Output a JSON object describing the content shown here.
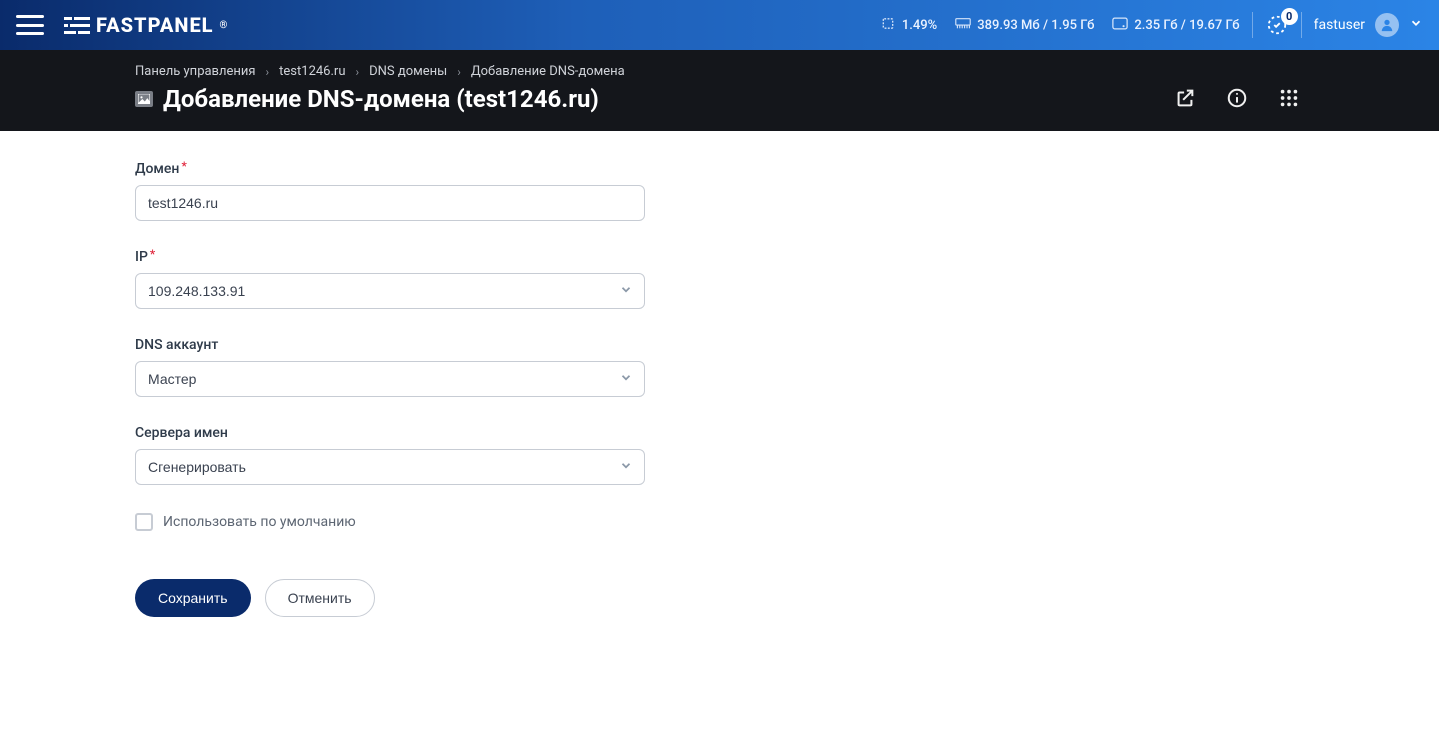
{
  "header": {
    "logo_text": "FASTPANEL",
    "stats": {
      "cpu": "1.49%",
      "memory": "389.93 Мб / 1.95 Гб",
      "disk": "2.35 Гб / 19.67 Гб"
    },
    "notifications_count": "0",
    "username": "fastuser"
  },
  "subheader": {
    "breadcrumbs": [
      "Панель управления",
      "test1246.ru",
      "DNS домены",
      "Добавление DNS-домена"
    ],
    "page_title": "Добавление DNS-домена (test1246.ru)"
  },
  "form": {
    "domain_label": "Домен",
    "domain_value": "test1246.ru",
    "ip_label": "IP",
    "ip_value": "109.248.133.91",
    "dns_account_label": "DNS аккаунт",
    "dns_account_value": "Мастер",
    "nameservers_label": "Сервера имен",
    "nameservers_value": "Сгенерировать",
    "use_default_label": "Использовать по умолчанию",
    "save_label": "Сохранить",
    "cancel_label": "Отменить"
  }
}
